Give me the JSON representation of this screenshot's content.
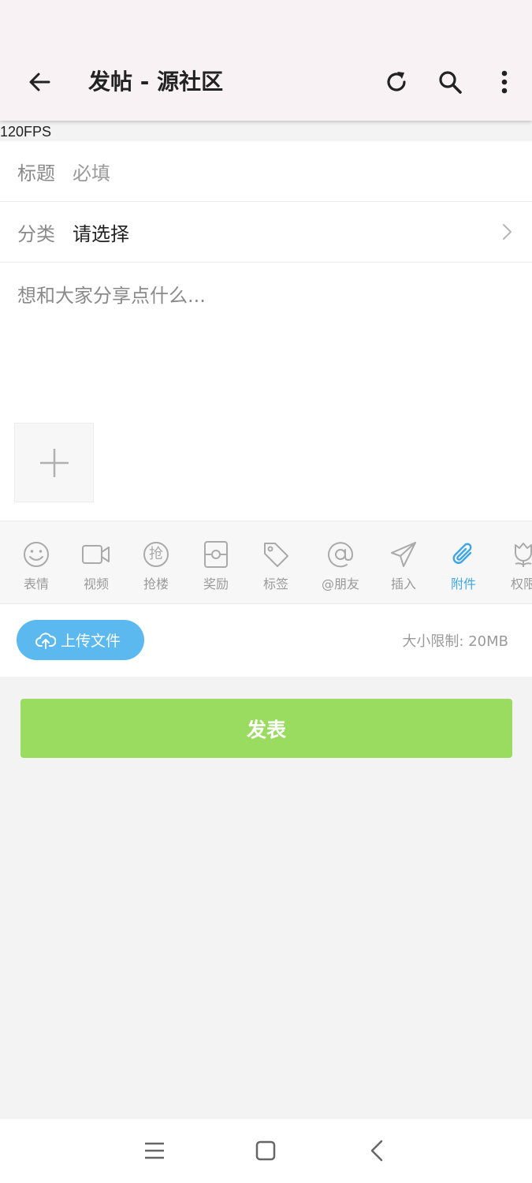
{
  "header": {
    "title": "发帖 - 源社区",
    "icons": {
      "back": "arrow-left-icon",
      "refresh": "refresh-icon",
      "search": "search-icon",
      "more": "more-vertical-icon"
    }
  },
  "fps": "120FPS",
  "form": {
    "title_label": "标题",
    "title_placeholder": "必填",
    "category_label": "分类",
    "category_value": "请选择",
    "content_placeholder": "想和大家分享点什么..."
  },
  "toolbar": {
    "items": [
      {
        "label": "表情",
        "icon": "smiley-icon"
      },
      {
        "label": "视频",
        "icon": "video-icon"
      },
      {
        "label": "抢楼",
        "icon": "grab-floor-icon"
      },
      {
        "label": "奖励",
        "icon": "reward-icon"
      },
      {
        "label": "标签",
        "icon": "tag-icon"
      },
      {
        "label": "@朋友",
        "icon": "at-icon"
      },
      {
        "label": "插入",
        "icon": "paper-plane-icon"
      },
      {
        "label": "附件",
        "icon": "paperclip-icon",
        "active": true
      },
      {
        "label": "权限",
        "icon": "tulip-icon"
      }
    ],
    "active_color": "#40a7e3",
    "inactive_color": "#9a9a9a"
  },
  "upload": {
    "button_label": "上传文件",
    "limit_text": "大小限制: 20MB",
    "button_color": "#5bb9ef"
  },
  "submit_label": "发表",
  "submit_color": "#99dc60",
  "navbar": {
    "icons": [
      "menu-icon",
      "home-square-icon",
      "back-chevron-icon"
    ]
  }
}
